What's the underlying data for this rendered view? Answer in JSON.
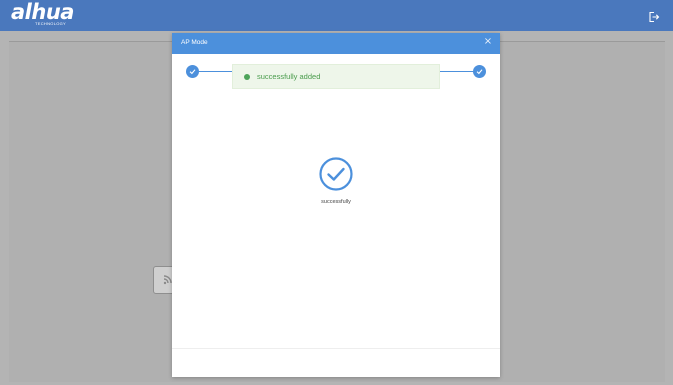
{
  "header": {
    "logo_text": "alhua",
    "logo_subtext": "TECHNOLOGY",
    "logout_icon": "logout-icon"
  },
  "modal": {
    "title": "AP Mode",
    "close_label": "×",
    "toast_message": "successfully added",
    "result_text": "successfully",
    "steps_completed": 2
  },
  "colors": {
    "header": "#4a78bd",
    "modal_header": "#4c90dc",
    "accent": "#4c90dc",
    "success": "#4da45a",
    "overlay": "#b4b4b4"
  }
}
